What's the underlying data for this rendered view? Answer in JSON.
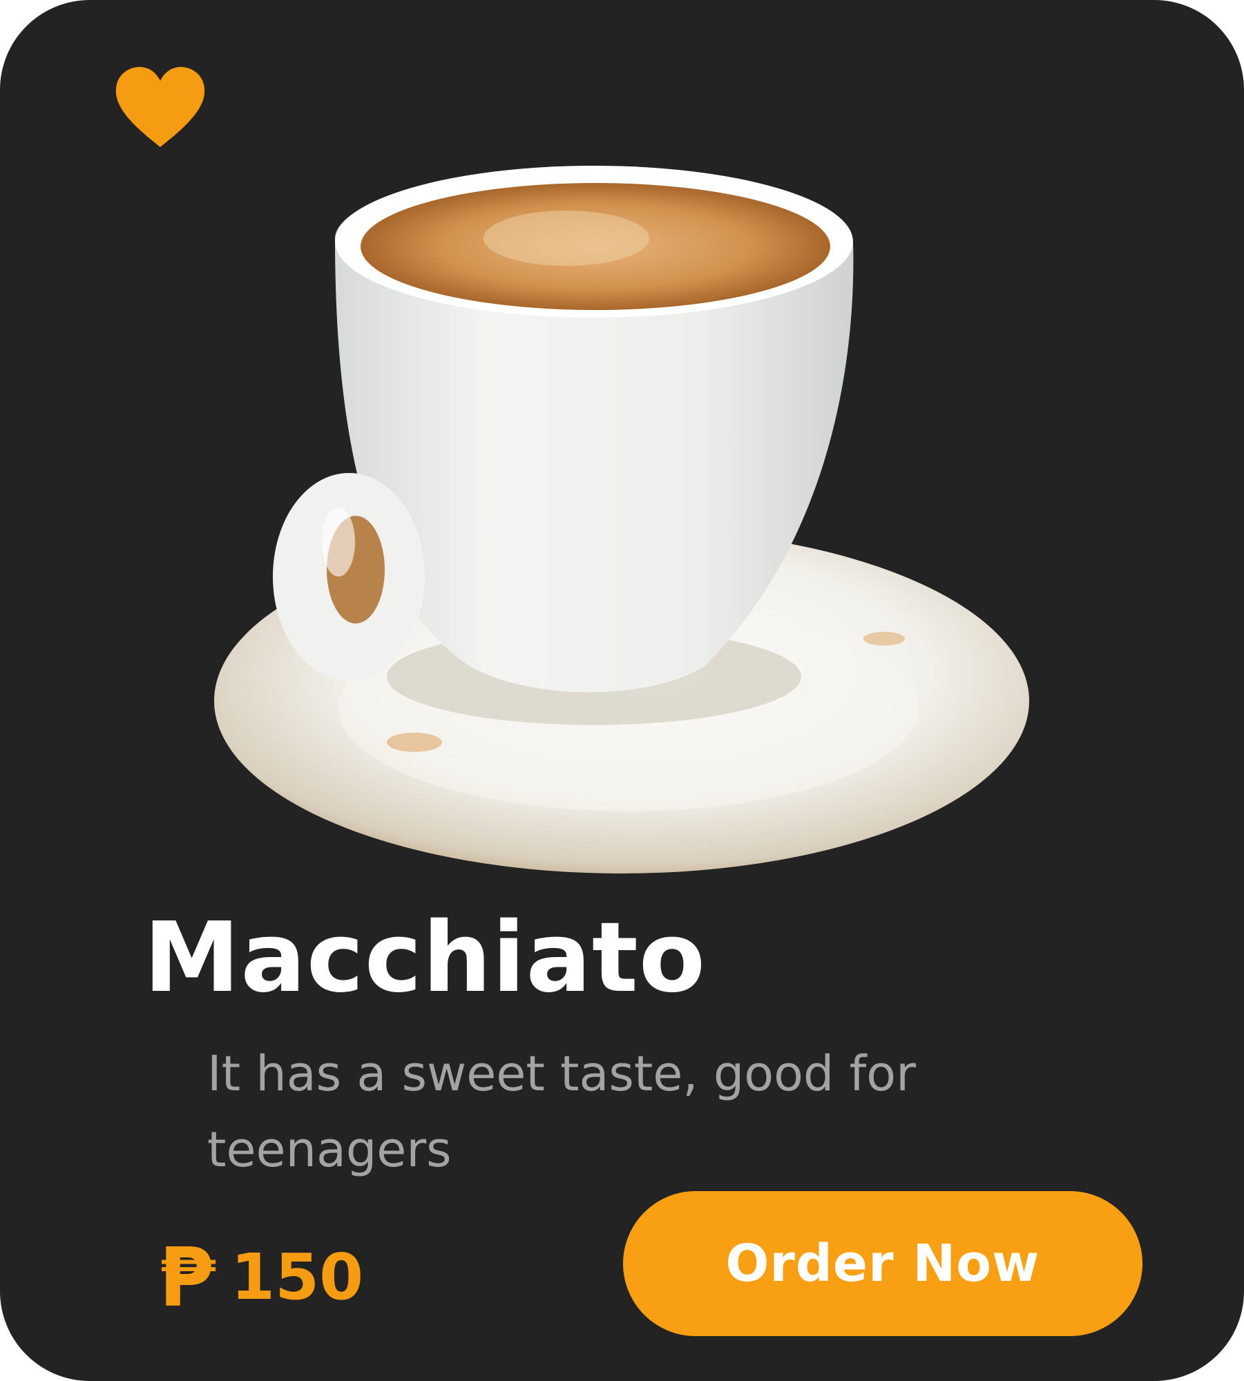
{
  "product": {
    "name": "Macchiato",
    "description": "It has a sweet taste, good for teenagers",
    "price": {
      "currency_symbol": "₱",
      "amount": "150"
    },
    "image_icon": "coffee-cup-icon"
  },
  "favorite": {
    "icon": "heart-icon",
    "color": "#F69C12"
  },
  "actions": {
    "order_label": "Order Now"
  },
  "colors": {
    "card_background": "#232323",
    "accent": "#F89F14",
    "title": "#FFFFFF",
    "description": "#A3A3A3"
  }
}
